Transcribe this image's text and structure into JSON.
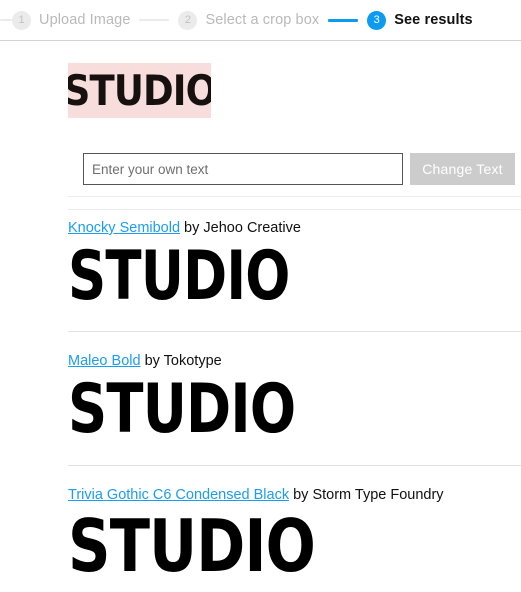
{
  "stepper": {
    "steps": [
      {
        "number": "1",
        "label": "Upload Image",
        "state": "inactive"
      },
      {
        "number": "2",
        "label": "Select a crop box",
        "state": "inactive"
      },
      {
        "number": "3",
        "label": "See results",
        "state": "active"
      }
    ],
    "active_color": "#0d9bf2",
    "inactive_color": "#b9b9b9"
  },
  "crop_preview": {
    "text": "STUDIO",
    "background_color": "#f7dedd",
    "text_color": "#16100f"
  },
  "text_form": {
    "input_value": "",
    "input_placeholder": "Enter your own text",
    "submit_label": "Change Text",
    "submit_bg_color": "#cccccc"
  },
  "results": [
    {
      "font_name": "Knocky Semibold",
      "by_text": " by Jehoo Creative",
      "foundry": "Jehoo Creative",
      "sample_text": "STUDIO",
      "link_color": "#1b9df0"
    },
    {
      "font_name": "Maleo Bold",
      "by_text": " by Tokotype",
      "foundry": "Tokotype",
      "sample_text": "STUDIO",
      "link_color": "#1b9df0"
    },
    {
      "font_name": "Trivia Gothic C6 Condensed Black",
      "by_text": " by Storm Type Foundry",
      "foundry": "Storm Type Foundry",
      "sample_text": "STUDIO",
      "link_color": "#1b9df0"
    }
  ]
}
